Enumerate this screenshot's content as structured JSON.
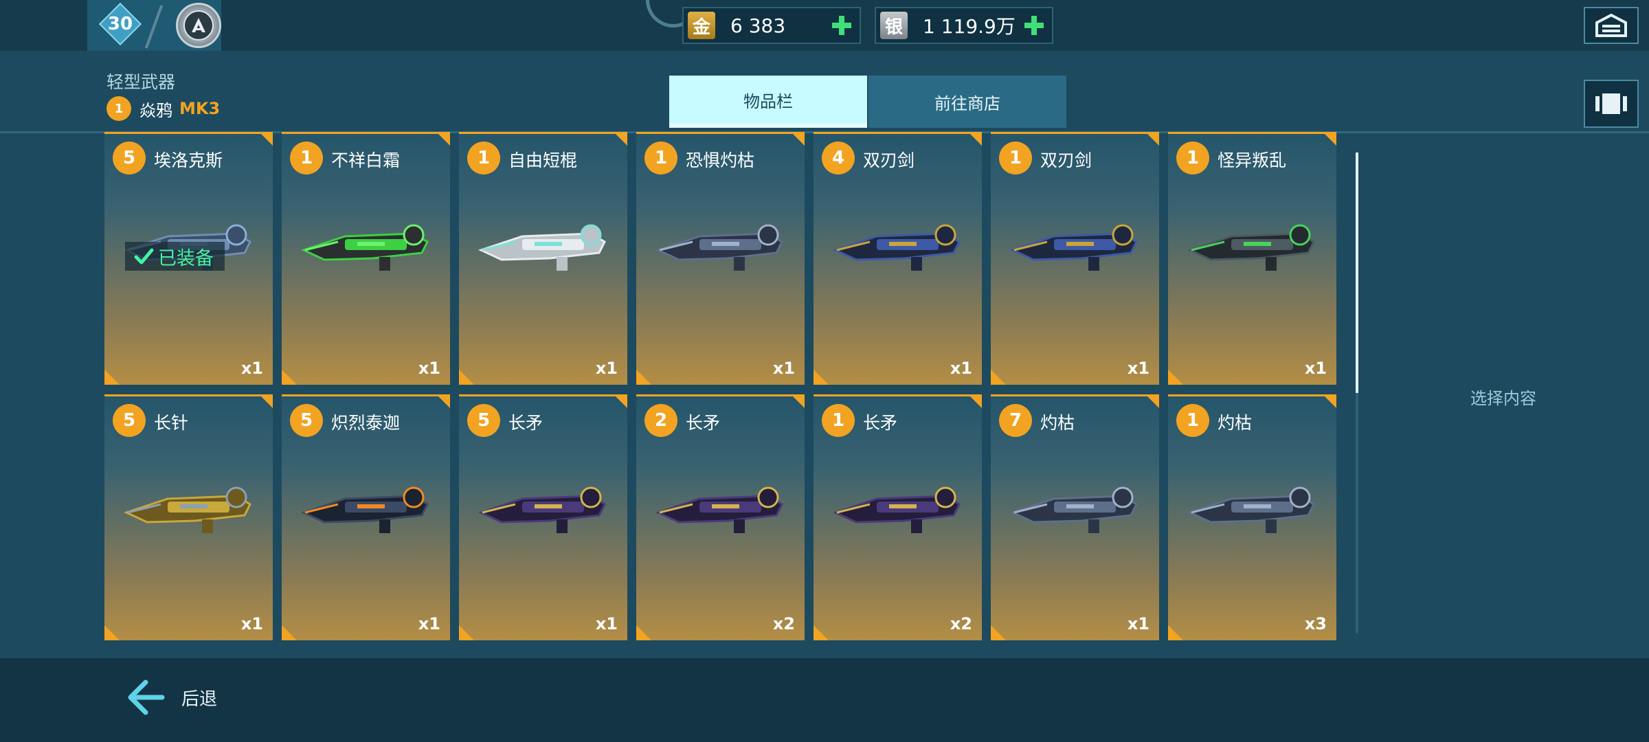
{
  "topbar": {
    "level": "30",
    "gold": {
      "icon_label": "金",
      "value": "6 383"
    },
    "silver": {
      "icon_label": "银",
      "value": "1 119.9万"
    }
  },
  "header": {
    "category": "轻型武器",
    "robot_level": "1",
    "robot_name": "焱鸦",
    "robot_mk": "MK3"
  },
  "tabs": {
    "inventory": "物品栏",
    "shop": "前往商店"
  },
  "equipped_label": "已装备",
  "side_panel": {
    "hint": "选择内容"
  },
  "footer": {
    "back_label": "后退"
  },
  "items": [
    {
      "level": "5",
      "name": "埃洛克斯",
      "qty": "x1",
      "icon": "heavy-cannon-blue",
      "equipped": true
    },
    {
      "level": "1",
      "name": "不祥白霜",
      "qty": "x1",
      "icon": "green-energy-launcher"
    },
    {
      "level": "1",
      "name": "自由短棍",
      "qty": "x1",
      "icon": "white-gatling"
    },
    {
      "level": "1",
      "name": "恐惧灼枯",
      "qty": "x1",
      "icon": "dark-blade-cannon"
    },
    {
      "level": "4",
      "name": "双刃剑",
      "qty": "x1",
      "icon": "twin-blade-launcher"
    },
    {
      "level": "1",
      "name": "双刃剑",
      "qty": "x1",
      "icon": "twin-blade-launcher"
    },
    {
      "level": "1",
      "name": "怪异叛乱",
      "qty": "x1",
      "icon": "green-long-rifle"
    },
    {
      "level": "5",
      "name": "长针",
      "qty": "x1",
      "icon": "gold-needle-gun"
    },
    {
      "level": "5",
      "name": "炽烈泰迦",
      "qty": "x1",
      "icon": "black-orange-cannon"
    },
    {
      "level": "5",
      "name": "长矛",
      "qty": "x1",
      "icon": "purple-spear-rifle"
    },
    {
      "level": "2",
      "name": "长矛",
      "qty": "x2",
      "icon": "purple-spear-rifle"
    },
    {
      "level": "1",
      "name": "长矛",
      "qty": "x2",
      "icon": "purple-spear-rifle"
    },
    {
      "level": "7",
      "name": "灼枯",
      "qty": "x1",
      "icon": "dark-blade-cannon"
    },
    {
      "level": "1",
      "name": "灼枯",
      "qty": "x3",
      "icon": "dark-blade-cannon"
    }
  ],
  "colors": {
    "accent": "#f2a321",
    "tab_active": "#c8fbff",
    "equipped_text": "#46f2a4",
    "plus": "#3fe07a"
  }
}
